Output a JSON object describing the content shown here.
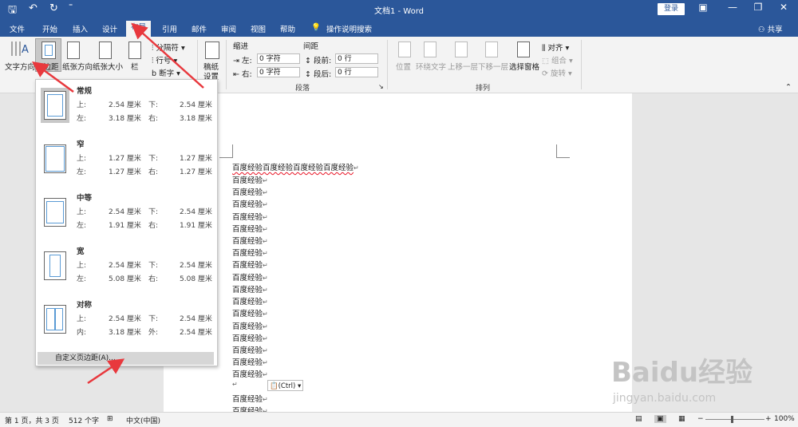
{
  "title_bar": {
    "doc_title": "文档1 - Word",
    "login_label": "登录",
    "qa_save": "🖫",
    "qa_undo": "↶",
    "qa_redo": "↻",
    "qa_customize": "⁼",
    "win_ribbon_opt": "▣",
    "win_min": "—",
    "win_max": "❐",
    "win_close": "✕"
  },
  "tabs": [
    "文件",
    "开始",
    "插入",
    "设计",
    "布局",
    "引用",
    "邮件",
    "审阅",
    "视图",
    "帮助"
  ],
  "tellme": "操作说明搜索",
  "share": "共享",
  "ribbon": {
    "text_direction": "文字方向",
    "margins": "页边距",
    "orientation": "纸张方向",
    "size": "纸张大小",
    "columns": "栏",
    "breaks": "分隔符",
    "line_numbers": "行号",
    "hyphenation": "断字",
    "draft_line1": "稿纸",
    "draft_line2": "设置",
    "indent_title": "缩进",
    "spacing_title": "间距",
    "left_label": "左:",
    "left_value": "0 字符",
    "right_label": "右:",
    "right_value": "0 字符",
    "before_label": "段前:",
    "before_value": "0 行",
    "after_label": "段后:",
    "after_value": "0 行",
    "paragraph_group": "段落",
    "position": "位置",
    "wrap_text": "环绕文字",
    "bring_forward": "上移一层",
    "send_backward": "下移一层",
    "selection_pane": "选择窗格",
    "align": "对齐",
    "group": "组合",
    "rotate": "旋转",
    "arrange_group": "排列"
  },
  "margin_menu": {
    "options": [
      {
        "name": "常规",
        "r1": [
          "上:",
          "2.54 厘米",
          "下:",
          "2.54 厘米"
        ],
        "r2": [
          "左:",
          "3.18 厘米",
          "右:",
          "3.18 厘米"
        ],
        "selected": true
      },
      {
        "name": "窄",
        "r1": [
          "上:",
          "1.27 厘米",
          "下:",
          "1.27 厘米"
        ],
        "r2": [
          "左:",
          "1.27 厘米",
          "右:",
          "1.27 厘米"
        ],
        "selected": false
      },
      {
        "name": "中等",
        "r1": [
          "上:",
          "2.54 厘米",
          "下:",
          "2.54 厘米"
        ],
        "r2": [
          "左:",
          "1.91 厘米",
          "右:",
          "1.91 厘米"
        ],
        "selected": false
      },
      {
        "name": "宽",
        "r1": [
          "上:",
          "2.54 厘米",
          "下:",
          "2.54 厘米"
        ],
        "r2": [
          "左:",
          "5.08 厘米",
          "右:",
          "5.08 厘米"
        ],
        "selected": false
      },
      {
        "name": "对称",
        "r1": [
          "上:",
          "2.54 厘米",
          "下:",
          "2.54 厘米"
        ],
        "r2": [
          "内:",
          "3.18 厘米",
          "外:",
          "2.54 厘米"
        ],
        "selected": false
      }
    ],
    "custom": "自定义页边距(A)..."
  },
  "document": {
    "first_line": "百度经验百度经验百度经验百度经验",
    "repeat_line": "百度经验",
    "paragraph_mark": "↵",
    "paste_options": "(Ctrl)"
  },
  "status": {
    "page": "第 1 页，共 3 页",
    "words": "512 个字",
    "language": "中文(中国)",
    "zoom": "100%",
    "zoom_minus": "−",
    "zoom_plus": "+"
  },
  "watermark": {
    "brand": "Baidu经验",
    "url": "jingyan.baidu.com"
  },
  "colors": {
    "accent": "#2b579a",
    "annotation_arrow": "#e8383d",
    "margin_line": "#5b9bd5"
  }
}
